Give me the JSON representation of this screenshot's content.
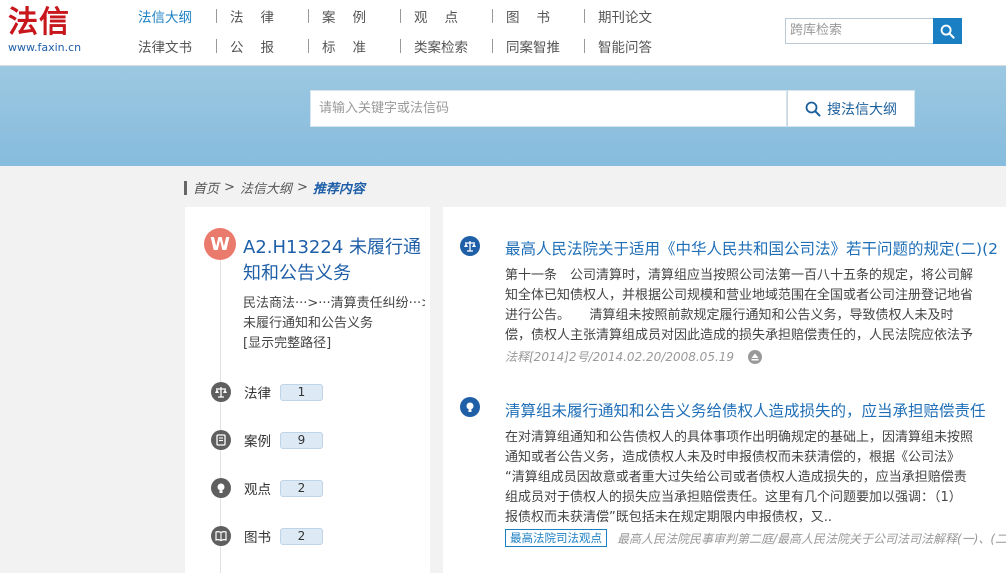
{
  "logo": {
    "name": "法信",
    "url": "www.faxin.cn"
  },
  "nav": {
    "row1": [
      "法信大纲",
      "法律",
      "案例",
      "观点",
      "图书",
      "期刊论文"
    ],
    "row2": [
      "法律文书",
      "公报",
      "标准",
      "类案检索",
      "同案智推",
      "智能问答"
    ]
  },
  "cross_search": {
    "placeholder": "跨库检索",
    "icon": "search-icon"
  },
  "main_search": {
    "placeholder": "请输入关键字或法信码",
    "button": "搜法信大纲"
  },
  "breadcrumb": {
    "home": "首页",
    "section": "法信大纲",
    "current": "推荐内容"
  },
  "topic": {
    "badge": "W",
    "title": "A2.H13224 未履行通知和公告义务",
    "path_line1": "民法商法···>···清算责任纠纷···>···",
    "path_line2": "未履行通知和公告义务",
    "full_path": "[显示完整路径]"
  },
  "categories": [
    {
      "label": "法律",
      "count": "1",
      "icon": "scales-icon"
    },
    {
      "label": "案例",
      "count": "9",
      "icon": "case-icon"
    },
    {
      "label": "观点",
      "count": "2",
      "icon": "lightbulb-icon"
    },
    {
      "label": "图书",
      "count": "2",
      "icon": "book-icon"
    }
  ],
  "results": [
    {
      "icon": "scales-icon",
      "title": "最高人民法院关于适用《中华人民共和国公司法》若干问题的规定(二)(2",
      "lines": [
        "第十一条　公司清算时，清算组应当按照公司法第一百八十五条的规定，将公司解",
        "知全体已知债权人，并根据公司规模和营业地域范围在全国或者公司注册登记地省",
        "进行公告。　　清算组未按照前款规定履行通知和公告义务，导致债权人未及时",
        "偿，债权人主张清算组成员对因此造成的损失承担赔偿责任的，人民法院应依法予"
      ],
      "meta": "法释[2014]2号/2014.02.20/2008.05.19"
    },
    {
      "icon": "lightbulb-icon",
      "title": "清算组未履行通知和公告义务给债权人造成损失的，应当承担赔偿责任",
      "lines": [
        "在对清算组通知和公告债权人的具体事项作出明确规定的基础上，因清算组未按照",
        "通知或者公告义务，造成债权人未及时申报债权而未获清偿的，根据《公司法》",
        "“清算组成员因故意或者重大过失给公司或者债权人造成损失的，应当承担赔偿责",
        "组成员对于债权人的损失应当承担赔偿责任。这里有几个问题要加以强调：（1）",
        "报债权而未获清偿”既包括未在规定期限内申报债权，又.."
      ],
      "tag": "最高法院司法观点",
      "meta": "最高人民法院民事审判第二庭/最高人民法院关于公司法司法解释(一)、(二"
    }
  ]
}
